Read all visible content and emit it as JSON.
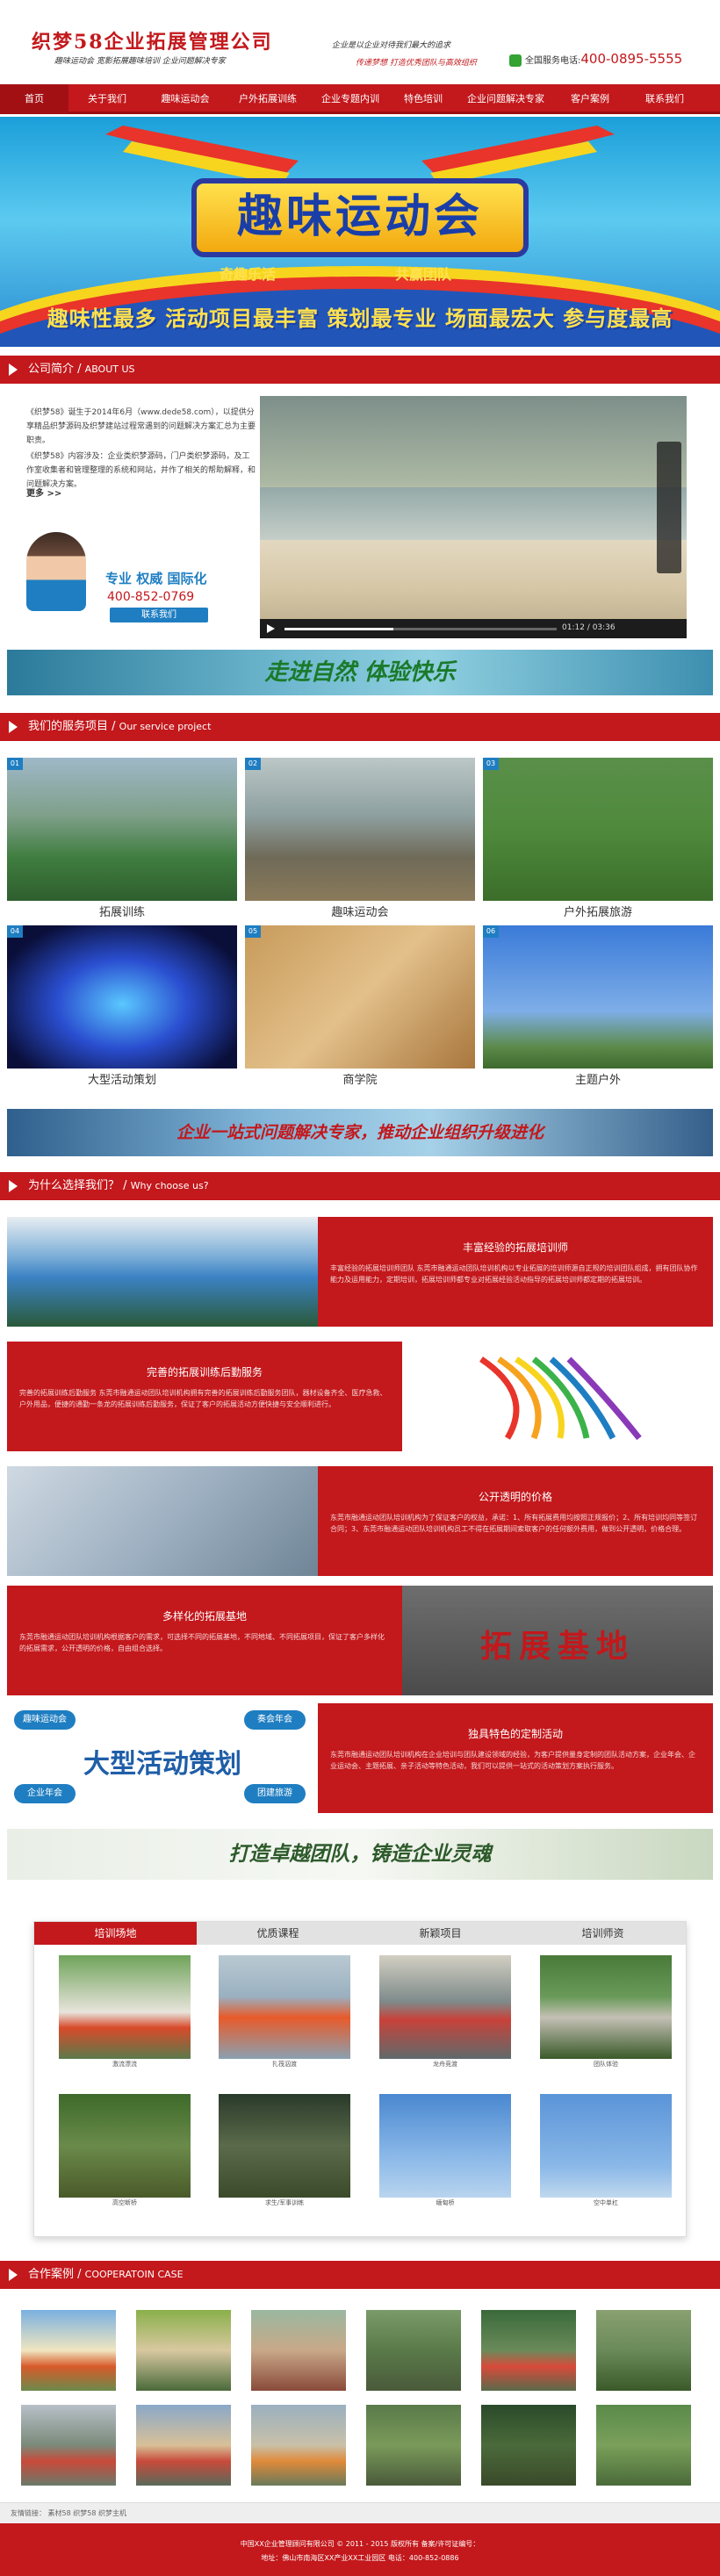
{
  "header": {
    "company": "织梦58企业拓展管理公司",
    "subline": "趣味运动会  宽影拓展趣味培训  企业问题解决专家",
    "slogan1": "企业是以企业对待我们最大的追求",
    "slogan2": "传递梦想  打造优秀团队与高效组织",
    "hotline_label": "全国服务电话:",
    "hotline_number": "400-0895-5555"
  },
  "nav": {
    "items": [
      "首页",
      "关于我们",
      "趣味运动会",
      "户外拓展训练",
      "企业专题内训",
      "特色培训",
      "企业问题解决专家",
      "客户案例",
      "联系我们"
    ]
  },
  "banner": {
    "main": "趣味运动会",
    "sub_left": "奇趣乐活",
    "sub_right": "共赢团队",
    "tagline": "趣味性最多  活动项目最丰富  策划最专业  场面最宏大  参与度最高"
  },
  "about": {
    "title": "公司简介",
    "title_en": "ABOUT US",
    "p1": "《织梦58》诞生于2014年6月（www.dede58.com），以提供分享精品织梦源码及织梦建站过程常遇到的问题解决方案汇总为主要职责。",
    "p2": "《织梦58》内容涉及：企业类织梦源码，门户类织梦源码，及工作室收集者和管理整理的系统和网站，并作了相关的帮助解释，和问题解决方案。",
    "more": "更多 >>",
    "contact_title": "专业  权威  国际化",
    "contact_phone": "400-852-0769",
    "contact_btn": "联系我们",
    "video_time": "01:12 / 03:36"
  },
  "strip1": {
    "text": "走进自然  体验快乐"
  },
  "services": {
    "title": "我们的服务项目",
    "title_en": "Our service project",
    "items": [
      {
        "num": "01",
        "label": "拓展训练"
      },
      {
        "num": "02",
        "label": "趣味运动会"
      },
      {
        "num": "03",
        "label": "户外拓展旅游"
      },
      {
        "num": "04",
        "label": "大型活动策划"
      },
      {
        "num": "05",
        "label": "商学院"
      },
      {
        "num": "06",
        "label": "主题户外"
      }
    ]
  },
  "strip2": {
    "text": "企业一站式问题解决专家，推动企业组织升级进化"
  },
  "why": {
    "title": "为什么选择我们？",
    "title_en": "Why choose us?",
    "rows": [
      {
        "heading": "丰富经验的拓展培训师",
        "body": "丰富经验的拓展培训师团队 东莞市融通运动团队培训机构以专业拓展的培训师源自正规的培训团队组成，拥有团队协作能力及运用能力，定期培训，拓展培训师都专业对拓展经验活动指导的拓展培训师都定期的拓展培训。"
      },
      {
        "heading": "完善的拓展训练后勤服务",
        "body": "完善的拓展训练后勤服务 东莞市融通运动团队培训机构拥有完善的拓展训练后勤服务团队，器材设备齐全、医疗急救、户外用品，便捷的通勤一条龙的拓展训练后勤服务，保证了客户的拓展活动方便快捷与安全顺利进行。"
      },
      {
        "heading": "公开透明的价格",
        "body": "东莞市融通运动团队培训机构为了保证客户的权益，承诺：1、所有拓展费用均按照正规报价；2、所有培训均同等签订合同；3、东莞市融通运动团队培训机构员工不得在拓展期间索取客户的任何额外费用，做到公开透明，价格合理。"
      },
      {
        "heading": "多样化的拓展基地",
        "body": "东莞市融通运动团队培训机构根据客户的需求，可选择不同的拓展基地，不同地域、不同拓展项目，保证了客户多样化的拓展需求，公开透明的价格，自由组合选择。"
      },
      {
        "heading": "独具特色的定制活动",
        "body": "东莞市融通运动团队培训机构在企业培训与团队建设领域的经验，为客户提供量身定制的团队活动方案，企业年会、企业运动会、主题拓展、亲子活动等特色活动，我们可以提供一站式的活动策划方案执行服务。"
      }
    ],
    "big_label": "大型活动策划",
    "pill1": "趣味运动会",
    "pill2": "奏会年会",
    "pill3": "企业年会",
    "pill4": "团建旅游",
    "banner4_text": "拓展基地"
  },
  "strip3": {
    "text": "打造卓越团队，铸造企业灵魂"
  },
  "gallery": {
    "tabs": [
      "培训场地",
      "优质课程",
      "新颖项目",
      "培训师资"
    ],
    "captions": [
      "激流漂流",
      "扎筏泅渡",
      "龙舟竞渡",
      "团队体验",
      "高空断桥",
      "求生/军事训练",
      "缅甸桥",
      "空中单杠"
    ]
  },
  "coop": {
    "title": "合作案例",
    "title_en": "COOPERATOIN CASE"
  },
  "friends": {
    "text": "友情链接：  素材58  织梦58  织梦主机"
  },
  "footer": {
    "line1": "中国XX企业管理顾问有限公司 © 2011 - 2015 版权所有  备案/许可证编号：",
    "line2": "地址：佛山市南海区XX产业XX工业园区 电话：400-852-0886"
  },
  "colors": {
    "primary": "#c3181c",
    "accent": "#1f7ec2",
    "banner_yellow": "#ffe14d"
  }
}
